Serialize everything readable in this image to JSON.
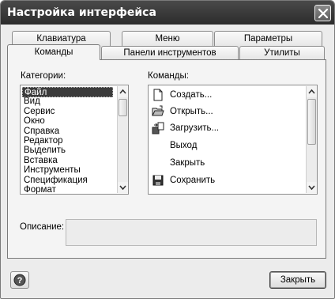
{
  "window": {
    "title": "Настройка интерфейса"
  },
  "tabs": {
    "row1": [
      "Клавиатура",
      "Меню",
      "Параметры"
    ],
    "row2": [
      "Команды",
      "Панели инструментов",
      "Утилиты"
    ],
    "active": "Команды"
  },
  "categories": {
    "label": "Категории:",
    "items": [
      "Файл",
      "Вид",
      "Сервис",
      "Окно",
      "Справка",
      "Редактор",
      "Выделить",
      "Вставка",
      "Инструменты",
      "Спецификация",
      "Формат"
    ],
    "selected": "Файл"
  },
  "commands": {
    "label": "Команды:",
    "items": [
      {
        "label": "Создать...",
        "icon": "new-document-icon"
      },
      {
        "label": "Открыть...",
        "icon": "open-folder-icon"
      },
      {
        "label": "Загрузить...",
        "icon": "load-icon"
      },
      {
        "label": "Выход",
        "icon": ""
      },
      {
        "label": "Закрыть",
        "icon": ""
      },
      {
        "label": "Сохранить",
        "icon": "save-disk-icon"
      }
    ]
  },
  "description": {
    "label": "Описание:",
    "value": ""
  },
  "buttons": {
    "help": "?",
    "close": "Закрыть"
  }
}
